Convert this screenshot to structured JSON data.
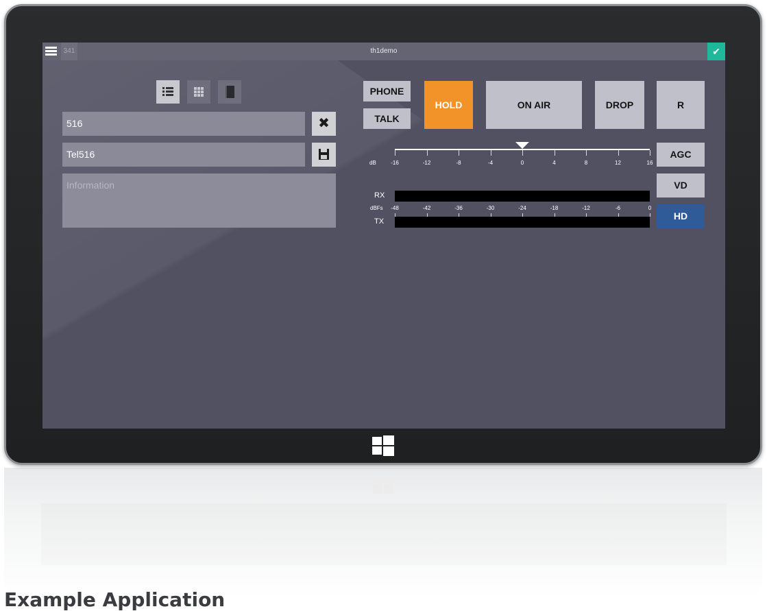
{
  "topbar": {
    "line_id": "341",
    "title": "th1demo",
    "status_icon": "check-icon"
  },
  "views": {
    "items": [
      {
        "name": "list-view",
        "icon": "list-icon",
        "active": true
      },
      {
        "name": "grid-view",
        "icon": "grid-icon",
        "active": false
      },
      {
        "name": "book-view",
        "icon": "book-icon",
        "active": false
      }
    ]
  },
  "caller": {
    "number": "516",
    "name": "Tel516",
    "info_placeholder": "Information"
  },
  "buttons": {
    "phone": "PHONE",
    "talk": "TALK",
    "hold": "HOLD",
    "on_air": "ON AIR",
    "drop": "DROP",
    "r": "R",
    "agc": "AGC",
    "vd": "VD",
    "hd": "HD"
  },
  "gain": {
    "unit": "dB",
    "ticks": [
      "-16",
      "-12",
      "-8",
      "-4",
      "0",
      "4",
      "8",
      "12",
      "16"
    ],
    "value": 0,
    "min": -16,
    "max": 16
  },
  "meters": {
    "rx_label": "RX",
    "tx_label": "TX",
    "unit": "dBFs",
    "ticks": [
      "-48",
      "-42",
      "-36",
      "-30",
      "-24",
      "-18",
      "-12",
      "-6",
      "0"
    ]
  },
  "colors": {
    "screen_bg": "#515162",
    "hold": "#f2932a",
    "hd": "#2f5c99",
    "status": "#1fb89a"
  },
  "caption": "Example Application"
}
